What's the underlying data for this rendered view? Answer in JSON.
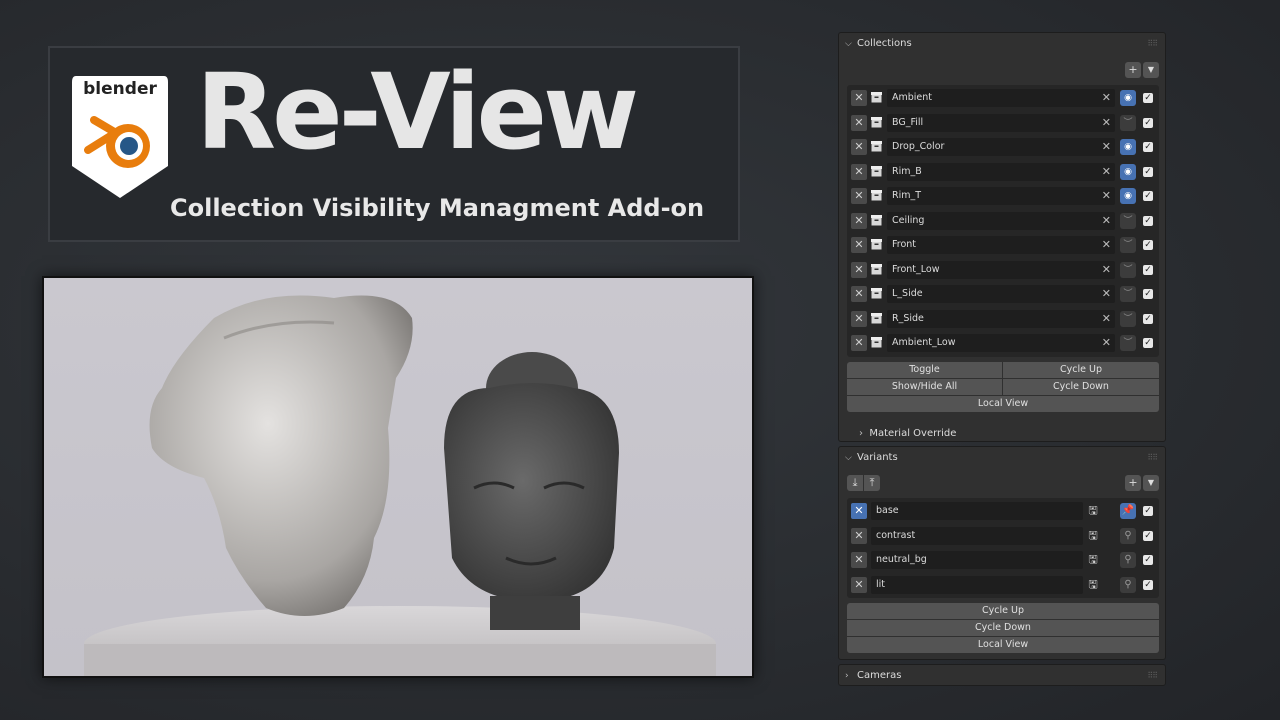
{
  "title": {
    "logo_text": "blender",
    "main": "Re-View",
    "subtitle": "Collection Visibility Managment Add-on"
  },
  "collections_panel": {
    "header": "Collections",
    "rows": [
      {
        "name": "Ambient",
        "visible": true
      },
      {
        "name": "BG_Fill",
        "visible": false
      },
      {
        "name": "Drop_Color",
        "visible": true
      },
      {
        "name": "Rim_B",
        "visible": true
      },
      {
        "name": "Rim_T",
        "visible": true
      },
      {
        "name": "Ceiling",
        "visible": false
      },
      {
        "name": "Front",
        "visible": false
      },
      {
        "name": "Front_Low",
        "visible": false
      },
      {
        "name": "L_Side",
        "visible": false
      },
      {
        "name": "R_Side",
        "visible": false
      },
      {
        "name": "Ambient_Low",
        "visible": false
      }
    ],
    "buttons": {
      "toggle": "Toggle",
      "cycle_up": "Cycle Up",
      "show_hide_all": "Show/Hide All",
      "cycle_down": "Cycle Down",
      "local_view": "Local View"
    },
    "material_override": "Material Override"
  },
  "variants_panel": {
    "header": "Variants",
    "rows": [
      {
        "name": "base",
        "active": true
      },
      {
        "name": "contrast",
        "active": false
      },
      {
        "name": "neutral_bg",
        "active": false
      },
      {
        "name": "lit",
        "active": false
      }
    ],
    "buttons": {
      "cycle_up": "Cycle Up",
      "cycle_down": "Cycle Down",
      "local_view": "Local View"
    }
  },
  "cameras_panel": {
    "header": "Cameras"
  },
  "colors": {
    "accent_blue": "#4772b3",
    "blender_orange": "#e87d0d",
    "blender_blue": "#265787"
  }
}
